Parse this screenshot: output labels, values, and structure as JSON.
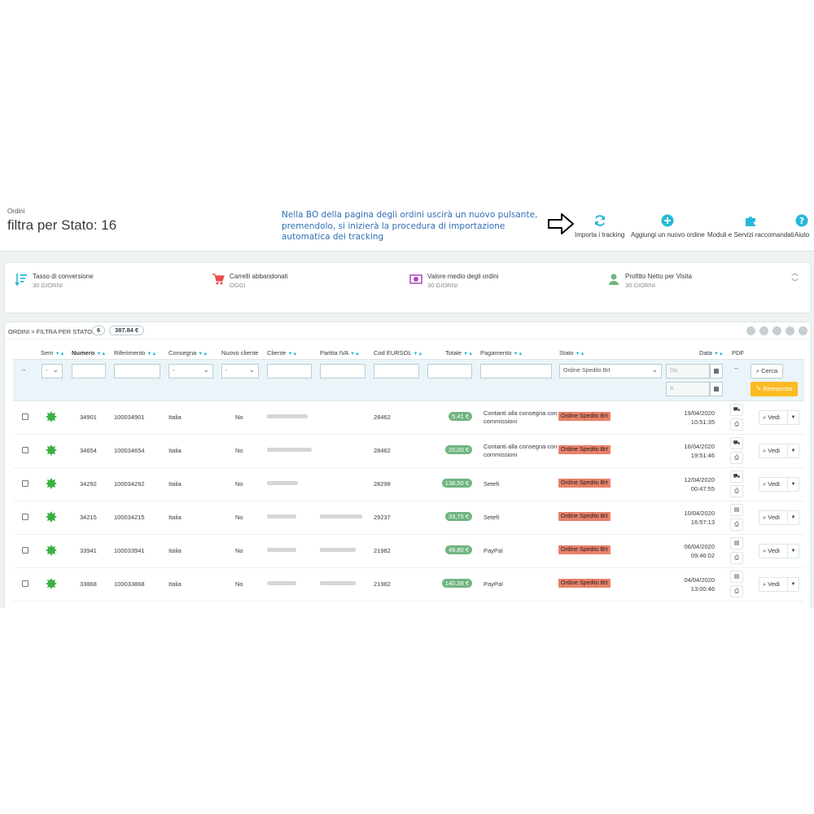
{
  "header": {
    "breadcrumb": "Ordini",
    "title": "filtra per Stato: 16",
    "note": "Nella BO della pagina degli ordini uscirà un nuovo pulsante, premendolo, si inizierà la procedura di importazione automatica dei tracking",
    "toolbar": [
      {
        "label": "Importa i tracking",
        "icon": "refresh-icon"
      },
      {
        "label": "Aggiungi un nuovo ordine",
        "icon": "plus-circle-icon"
      },
      {
        "label": "Moduli e Servizi raccomandati",
        "icon": "puzzle-icon"
      },
      {
        "label": "Aiuto",
        "icon": "help-icon"
      }
    ]
  },
  "kpis": [
    {
      "label": "Tasso di conversione",
      "sub": "30 GIORNI",
      "icon": "sort-icon",
      "color": "#25b9d7"
    },
    {
      "label": "Carrelli abbandonati",
      "sub": "OGGI",
      "icon": "cart-icon",
      "color": "#e84e4e"
    },
    {
      "label": "Valore medio degli ordini",
      "sub": "30 GIORNI",
      "icon": "money-icon",
      "color": "#ab47bc"
    },
    {
      "label": "Profitto Netto per Visita",
      "sub": "30 GIORNI",
      "icon": "user-icon",
      "color": "#70b580"
    }
  ],
  "panel": {
    "title": "Ordini > filtra per Stato: 16",
    "count": "6",
    "total": "387.84 €"
  },
  "columns": {
    "sem": "Sem",
    "numero": "Numero",
    "riferimento": "Riferimento",
    "consegna": "Consegna",
    "nuovo_cliente": "Nuovo cliente",
    "cliente": "Cliente",
    "partita_iva": "Partita IVA",
    "cod_eursol": "Cod EURSOL",
    "totale": "Totale",
    "pagamento": "Pagamento",
    "stato": "Stato",
    "data": "Data",
    "pdf": "PDF"
  },
  "filters": {
    "dash": "--",
    "sem_value": "-",
    "consegna_value": "-",
    "nuovo_cliente_value": "-",
    "stato_value": "Ordine Spedito Brt",
    "date_from": "Da",
    "date_to": "A",
    "data_dash": "--",
    "search_label": "Cerca",
    "reset_label": "Reimposta"
  },
  "orders": [
    {
      "numero": "34901",
      "riferimento": "100034901",
      "consegna": "Italia",
      "nuovo": "No",
      "cod": "28462",
      "totale": "5,41 €",
      "pagamento": "Contanti alla consegna con commissioni",
      "stato": "Ordine Spedito Brt",
      "data": "19/04/2020",
      "ora": "10:51:35",
      "vedi": "Vedi"
    },
    {
      "numero": "34654",
      "riferimento": "100034654",
      "consegna": "Italia",
      "nuovo": "No",
      "cod": "28462",
      "totale": "20,00 €",
      "pagamento": "Contanti alla consegna con commissioni",
      "stato": "Ordine Spedito Brt",
      "data": "16/04/2020",
      "ora": "19:51:46",
      "vedi": "Vedi"
    },
    {
      "numero": "34292",
      "riferimento": "100034292",
      "consegna": "Italia",
      "nuovo": "No",
      "cod": "28298",
      "totale": "138,50 €",
      "pagamento": "Setefi",
      "stato": "Ordine Spedito Brt",
      "data": "12/04/2020",
      "ora": "00:47:55",
      "vedi": "Vedi"
    },
    {
      "numero": "34215",
      "riferimento": "100034215",
      "consegna": "Italia",
      "nuovo": "No",
      "cod": "29237",
      "totale": "33,75 €",
      "pagamento": "Setefi",
      "stato": "Ordine Spedito Brt",
      "data": "10/04/2020",
      "ora": "16:57:13",
      "vedi": "Vedi"
    },
    {
      "numero": "33941",
      "riferimento": "100033941",
      "consegna": "Italia",
      "nuovo": "No",
      "cod": "21982",
      "totale": "49,80 €",
      "pagamento": "PayPal",
      "stato": "Ordine Spedito Brt",
      "data": "06/04/2020",
      "ora": "09:46:02",
      "vedi": "Vedi"
    },
    {
      "numero": "33868",
      "riferimento": "100033868",
      "consegna": "Italia",
      "nuovo": "No",
      "cod": "21982",
      "totale": "140,38 €",
      "pagamento": "PayPal",
      "stato": "Ordine Spedito Brt",
      "data": "04/04/2020",
      "ora": "13:00:46",
      "vedi": "Vedi"
    }
  ]
}
